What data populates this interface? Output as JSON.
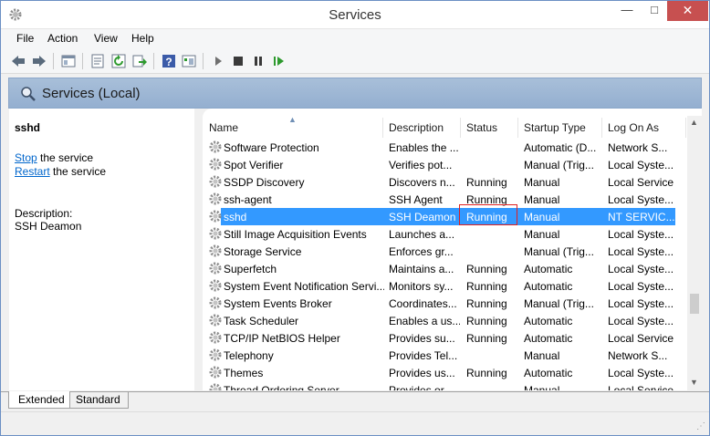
{
  "window": {
    "title": "Services"
  },
  "menu": [
    "File",
    "Action",
    "View",
    "Help"
  ],
  "toolbar_icons": [
    "back-icon",
    "forward-icon",
    "console-tree-icon",
    "properties-icon",
    "refresh-icon",
    "export-icon",
    "help-icon",
    "view-icon",
    "start-icon",
    "stop-icon",
    "pause-icon",
    "restart-icon"
  ],
  "banner": {
    "title": "Services (Local)"
  },
  "details": {
    "service_name": "sshd",
    "stop_link": "Stop",
    "stop_suffix": " the service",
    "restart_link": "Restart",
    "restart_suffix": " the service",
    "description_label": "Description:",
    "description_value": "SSH Deamon"
  },
  "columns": [
    "Name",
    "Description",
    "Status",
    "Startup Type",
    "Log On As"
  ],
  "rows": [
    [
      "Software Protection",
      "Enables the ...",
      "",
      "Automatic (D...",
      "Network S..."
    ],
    [
      "Spot Verifier",
      "Verifies pot...",
      "",
      "Manual (Trig...",
      "Local Syste..."
    ],
    [
      "SSDP Discovery",
      "Discovers n...",
      "Running",
      "Manual",
      "Local Service"
    ],
    [
      "ssh-agent",
      "SSH Agent",
      "Running",
      "Manual",
      "Local Syste..."
    ],
    [
      "sshd",
      "SSH Deamon",
      "Running",
      "Manual",
      "NT SERVIC..."
    ],
    [
      "Still Image Acquisition Events",
      "Launches a...",
      "",
      "Manual",
      "Local Syste..."
    ],
    [
      "Storage Service",
      "Enforces gr...",
      "",
      "Manual (Trig...",
      "Local Syste..."
    ],
    [
      "Superfetch",
      "Maintains a...",
      "Running",
      "Automatic",
      "Local Syste..."
    ],
    [
      "System Event Notification Servi...",
      "Monitors sy...",
      "Running",
      "Automatic",
      "Local Syste..."
    ],
    [
      "System Events Broker",
      "Coordinates...",
      "Running",
      "Manual (Trig...",
      "Local Syste..."
    ],
    [
      "Task Scheduler",
      "Enables a us...",
      "Running",
      "Automatic",
      "Local Syste..."
    ],
    [
      "TCP/IP NetBIOS Helper",
      "Provides su...",
      "Running",
      "Automatic",
      "Local Service"
    ],
    [
      "Telephony",
      "Provides Tel...",
      "",
      "Manual",
      "Network S..."
    ],
    [
      "Themes",
      "Provides us...",
      "Running",
      "Automatic",
      "Local Syste..."
    ],
    [
      "Thread Ordering Server",
      "Provides or...",
      "",
      "Manual",
      "Local Service"
    ]
  ],
  "selected_row": 4,
  "tabs": [
    "Extended",
    "Standard"
  ]
}
